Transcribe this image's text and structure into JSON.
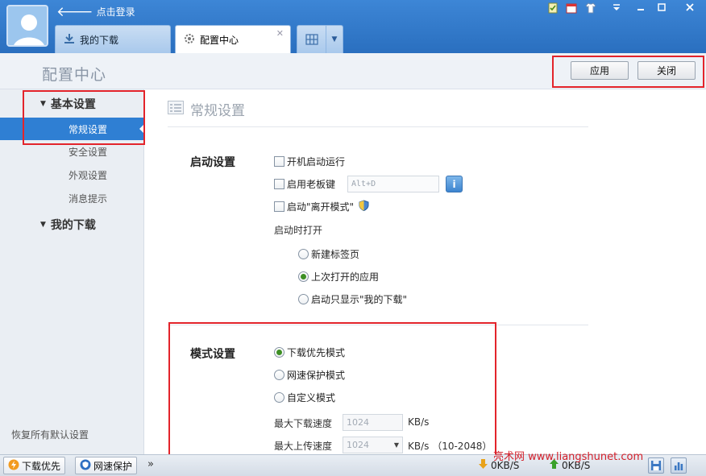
{
  "titlebar": {
    "login_text": "点击登录",
    "tabs": [
      {
        "label": "我的下载",
        "icon": "download-icon"
      },
      {
        "label": "配置中心",
        "icon": "gear-icon",
        "close": "✕"
      }
    ],
    "accent_color": "#2f7fd3"
  },
  "header": {
    "title": "配置中心",
    "apply_label": "应用",
    "close_label": "关闭"
  },
  "sidebar": {
    "groups": [
      {
        "label": "基本设置",
        "items": [
          {
            "label": "常规设置",
            "active": true
          },
          {
            "label": "安全设置"
          },
          {
            "label": "外观设置"
          },
          {
            "label": "消息提示"
          }
        ]
      },
      {
        "label": "我的下载",
        "items": []
      }
    ],
    "restore_label": "恢复所有默认设置"
  },
  "main": {
    "section_title": "常规设置",
    "startup": {
      "label": "启动设置",
      "auto_start": "开机启动运行",
      "boss_key": "启用老板键",
      "boss_key_value": "Alt+D",
      "away_mode": "启动\"离开模式\"",
      "open_on_start": "启动时打开",
      "open_options": [
        {
          "label": "新建标签页",
          "selected": false
        },
        {
          "label": "上次打开的应用",
          "selected": true
        },
        {
          "label": "启动只显示\"我的下载\"",
          "selected": false
        }
      ]
    },
    "mode": {
      "label": "模式设置",
      "options": [
        {
          "label": "下载优先模式",
          "selected": true
        },
        {
          "label": "网速保护模式",
          "selected": false
        },
        {
          "label": "自定义模式",
          "selected": false
        }
      ],
      "max_download_label": "最大下载速度",
      "max_download_value": "1024",
      "max_download_unit": "KB/s",
      "max_upload_label": "最大上传速度",
      "max_upload_value": "1024",
      "max_upload_unit": "KB/s （10-2048）"
    }
  },
  "statusbar": {
    "download_priority": "下载优先",
    "speed_protect": "网速保护",
    "more": "»",
    "down_speed": "0KB/S",
    "up_speed": "0KB/S"
  },
  "watermark": "亮术网 www.liangshunet.com"
}
